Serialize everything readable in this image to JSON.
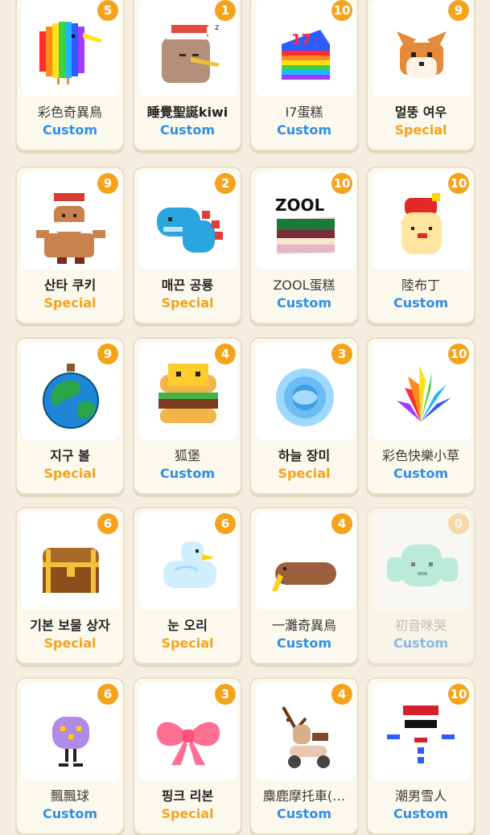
{
  "colors": {
    "custom": "#2f8fe6",
    "special": "#f5a31a",
    "badge": "#f5a31a"
  },
  "items": [
    {
      "name": "彩色奇異鳥",
      "tag": "Custom",
      "count": "5",
      "icon": "rainbow-kiwi-icon",
      "bold": false
    },
    {
      "name": "睡覺聖誕kiwi",
      "tag": "Custom",
      "count": "1",
      "icon": "sleeping-christmas-kiwi-icon",
      "bold": true
    },
    {
      "name": "I7蛋糕",
      "tag": "Custom",
      "count": "10",
      "icon": "rainbow-cake-icon",
      "bold": false
    },
    {
      "name": "멀뚱 여우",
      "tag": "Special",
      "count": "9",
      "icon": "fox-icon",
      "bold": true
    },
    {
      "name": "산타 쿠키",
      "tag": "Special",
      "count": "9",
      "icon": "gingerbread-santa-icon",
      "bold": true
    },
    {
      "name": "매끈 공룡",
      "tag": "Special",
      "count": "2",
      "icon": "blue-dinosaur-icon",
      "bold": true
    },
    {
      "name": "ZOOL蛋糕",
      "tag": "Custom",
      "count": "10",
      "icon": "zool-cake-icon",
      "bold": false
    },
    {
      "name": "陸布丁",
      "tag": "Custom",
      "count": "10",
      "icon": "pudding-icon",
      "bold": false
    },
    {
      "name": "지구 볼",
      "tag": "Special",
      "count": "9",
      "icon": "earth-ornament-icon",
      "bold": true
    },
    {
      "name": "狐堡",
      "tag": "Custom",
      "count": "4",
      "icon": "fox-burger-icon",
      "bold": false
    },
    {
      "name": "하늘 장미",
      "tag": "Special",
      "count": "3",
      "icon": "blue-rose-icon",
      "bold": true
    },
    {
      "name": "彩色快樂小草",
      "tag": "Custom",
      "count": "10",
      "icon": "rainbow-grass-icon",
      "bold": false
    },
    {
      "name": "기본 보물 상자",
      "tag": "Special",
      "count": "6",
      "icon": "treasure-chest-icon",
      "bold": true
    },
    {
      "name": "눈 오리",
      "tag": "Special",
      "count": "6",
      "icon": "snow-duck-icon",
      "bold": true
    },
    {
      "name": "一灘奇異鳥",
      "tag": "Custom",
      "count": "4",
      "icon": "flat-kiwi-icon",
      "bold": false
    },
    {
      "name": "初音咪哭",
      "tag": "Custom",
      "count": "0",
      "icon": "teal-character-icon",
      "bold": false,
      "dim": true
    },
    {
      "name": "飄飄球",
      "tag": "Custom",
      "count": "6",
      "icon": "purple-ball-icon",
      "bold": false
    },
    {
      "name": "핑크 리본",
      "tag": "Special",
      "count": "3",
      "icon": "pink-ribbon-icon",
      "bold": true
    },
    {
      "name": "麋鹿摩托車(…",
      "tag": "Custom",
      "count": "4",
      "icon": "reindeer-scooter-icon",
      "bold": false
    },
    {
      "name": "潮男雪人",
      "tag": "Custom",
      "count": "10",
      "icon": "cool-snowman-icon",
      "bold": false
    }
  ]
}
